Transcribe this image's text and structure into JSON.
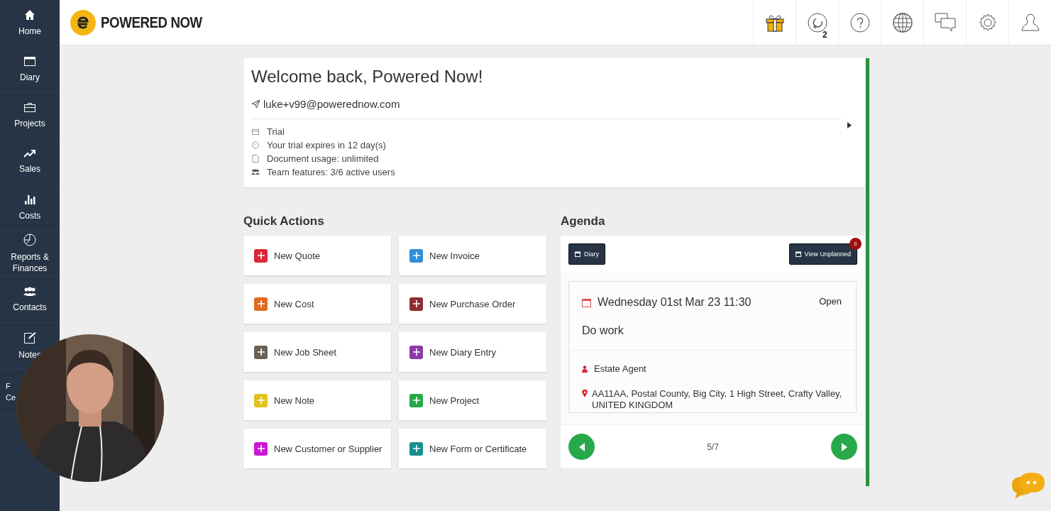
{
  "sidebar": {
    "items": [
      {
        "lines": [
          "Home"
        ]
      },
      {
        "lines": [
          "Diary"
        ]
      },
      {
        "lines": [
          "Projects"
        ]
      },
      {
        "lines": [
          "Sales"
        ]
      },
      {
        "lines": [
          "Costs"
        ]
      },
      {
        "lines": [
          "Reports &",
          "Finances"
        ]
      },
      {
        "lines": [
          "Contacts"
        ]
      },
      {
        "lines": [
          "Notes"
        ]
      },
      {
        "lines": [
          "F",
          "Ce"
        ]
      }
    ]
  },
  "header": {
    "logo_text": "POWERED NOW",
    "refresh_count": "2"
  },
  "welcome": {
    "title": "Welcome back, Powered Now!",
    "email": "luke+v99@powerednow.com",
    "details": [
      {
        "text": "Trial"
      },
      {
        "text": "Your trial expires in 12 day(s)"
      },
      {
        "text": "Document usage: unlimited"
      },
      {
        "text": "Team features: 3/6 active users"
      }
    ]
  },
  "quick_actions": {
    "title": "Quick Actions",
    "items": [
      {
        "label": "New Quote",
        "color": "#d9283a"
      },
      {
        "label": "New Invoice",
        "color": "#2f8fd8"
      },
      {
        "label": "New Cost",
        "color": "#e06a1f"
      },
      {
        "label": "New Purchase Order",
        "color": "#8e2d33"
      },
      {
        "label": "New Job Sheet",
        "color": "#6b6154"
      },
      {
        "label": "New Diary Entry",
        "color": "#8b3aa8"
      },
      {
        "label": "New Note",
        "color": "#e3c21c"
      },
      {
        "label": "New Project",
        "color": "#27a94a"
      },
      {
        "label": "New Customer or Supplier",
        "color": "#cc17d8"
      },
      {
        "label": "New Form or Certificate",
        "color": "#16908f"
      }
    ]
  },
  "agenda": {
    "title": "Agenda",
    "diary_button": "Diary",
    "unplanned_button": "View Unplanned",
    "unplanned_badge": "0",
    "event": {
      "date": "Wednesday 01st Mar 23 11:30",
      "status": "Open",
      "title": "Do work",
      "contact": "Estate Agent",
      "address": "AA11AA, Postal County, Big City, 1 High Street, Crafty Valley, UNITED KINGDOM"
    },
    "pager": "5/7"
  }
}
